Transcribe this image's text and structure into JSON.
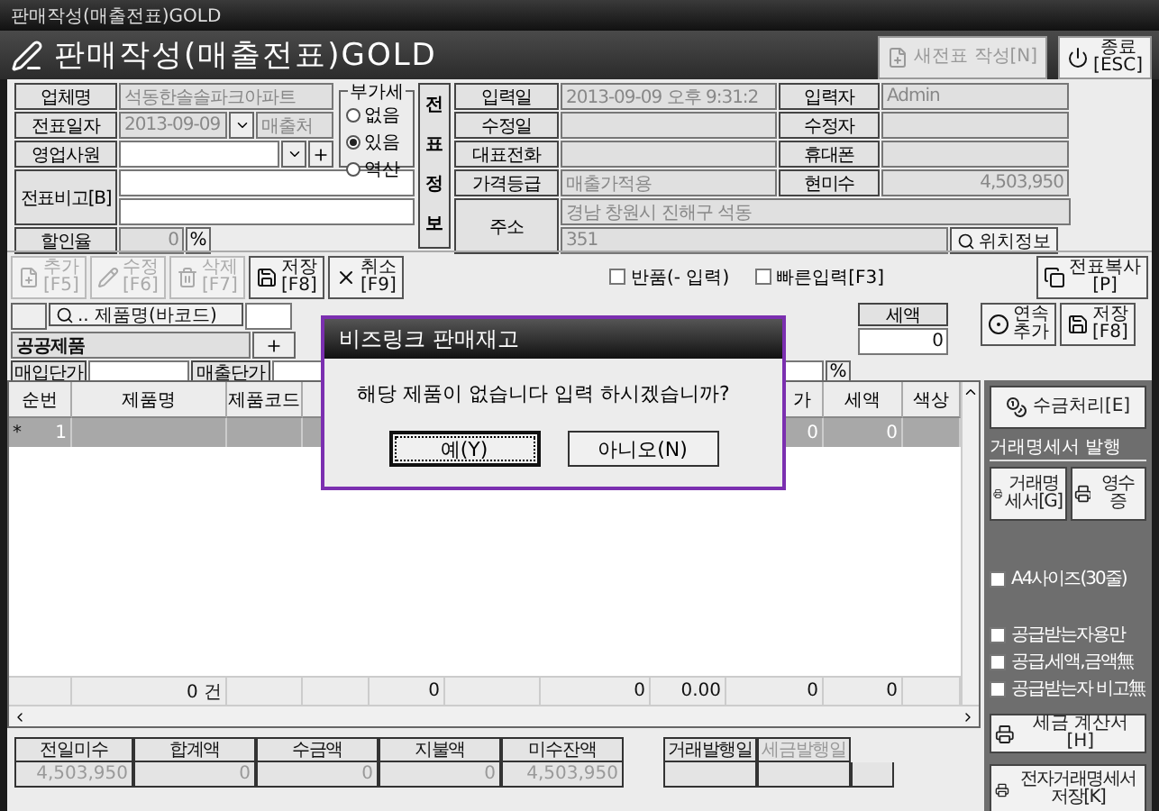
{
  "window": {
    "title": "판매작성(매출전표)GOLD"
  },
  "header": {
    "title": "판매작성(매출전표)GOLD",
    "buttons": [
      {
        "kind": "new",
        "label": "새전표 작성[N]",
        "disabled": true
      },
      {
        "kind": "exit",
        "label": "종료",
        "key": "[ESC]",
        "disabled": false
      }
    ]
  },
  "form": {
    "company": {
      "label": "업체명",
      "value": "석동한솔솔파크아파트"
    },
    "date": {
      "label": "전표일자",
      "value": "2013-09-09",
      "customer_placeholder": "매출처"
    },
    "salesperson": {
      "label": "영업사원"
    },
    "memo": {
      "label": "전표비고[B]"
    },
    "discount": {
      "label": "할인율",
      "value": "0",
      "unit": "%"
    }
  },
  "vat": {
    "legend": "부가세",
    "options": [
      {
        "label": "없음",
        "selected": false
      },
      {
        "label": "있음",
        "selected": true
      },
      {
        "label": "역산",
        "selected": false
      }
    ]
  },
  "info": {
    "title": "전표정보",
    "rows": [
      {
        "label": "입력일",
        "value": "2013-09-09 오후 9:31:2",
        "label2": "입력자",
        "value2": "Admin"
      },
      {
        "label": "수정일",
        "label2": "수정자"
      },
      {
        "label": "대표전화",
        "label2": "휴대폰"
      },
      {
        "label": "가격등급",
        "value": "매출가적용",
        "label2": "현미수",
        "value2": "4,503,950"
      }
    ],
    "address": {
      "label": "주소",
      "line1": "경남 창원시 진해구 석동",
      "line2": "351",
      "button": "위치정보"
    }
  },
  "toolbar": {
    "buttons": [
      {
        "kind": "add",
        "label": "추가",
        "key": "[F5]",
        "disabled": true
      },
      {
        "kind": "edit",
        "label": "수정",
        "key": "[F6]",
        "disabled": true
      },
      {
        "kind": "delete",
        "label": "삭제",
        "key": "[F7]",
        "disabled": true
      },
      {
        "kind": "save",
        "label": "저장",
        "key": "[F8]",
        "disabled": false
      },
      {
        "kind": "cancel",
        "label": "취소",
        "key": "[F9]",
        "disabled": false
      }
    ],
    "checkboxes": [
      {
        "label": "반품(- 입력)",
        "checked": false
      },
      {
        "label": "빠른입력[F3]",
        "checked": false
      }
    ],
    "copy_button": {
      "label": "전표복사",
      "key": "[P]"
    }
  },
  "entry": {
    "search_button": "..  제품명(바코드)",
    "product": "공공제품",
    "purchase_price_label": "매입단가",
    "sale_price_label": "매출단가",
    "percent": "%",
    "tax_header": "세액",
    "tax_value": "0",
    "buttons": [
      {
        "kind": "continuous",
        "label": "연속",
        "key": "추가"
      },
      {
        "kind": "save",
        "label": "저장",
        "key": "[F8]"
      }
    ]
  },
  "table": {
    "columns": [
      {
        "header": "순번"
      },
      {
        "header": "제품명",
        "total": "0 건"
      },
      {
        "header": "제품코드"
      },
      {},
      {
        "total": "0"
      },
      {},
      {
        "total": "0"
      },
      {
        "total": "0.00"
      },
      {
        "header": "가",
        "total": "0"
      },
      {
        "header": "세액",
        "total": "0"
      },
      {
        "header": "색상"
      }
    ],
    "rows": [
      {
        "marker": "*",
        "selected": true,
        "number": "1",
        "amount": "0",
        "tax": "0"
      }
    ]
  },
  "sidebar": {
    "collect_button": "수금처리[E]",
    "group_title": "거래명세서 발행",
    "print_buttons": [
      "거래명세서[G]",
      "영수증"
    ],
    "options": [
      {
        "label": "A4사이즈(30줄)",
        "checked": false
      },
      {
        "label": "공급받는자용만",
        "checked": false
      },
      {
        "label": "공급,세액,금액無",
        "checked": false
      },
      {
        "label": "공급받는자 비고無",
        "checked": false
      }
    ],
    "tax_invoice_button": "세금 계산서[H]",
    "e_statement_button": "전자거래명세서 저장[K]"
  },
  "summary": {
    "fields": [
      {
        "label": "전일미수",
        "value": "4,503,950"
      },
      {
        "label": "합계액",
        "value": "0"
      },
      {
        "label": "수금액",
        "value": "0"
      },
      {
        "label": "지불액",
        "value": "0"
      },
      {
        "label": "미수잔액",
        "value": "4,503,950"
      }
    ],
    "dates": [
      {
        "label": "거래발행일",
        "disabled": false
      },
      {
        "label": "세금발행일",
        "disabled": true
      }
    ]
  },
  "dialog": {
    "title": "비즈링크 판매재고",
    "message": "해당 제품이 없습니다 입력 하시겠습니까?",
    "buttons": [
      {
        "label": "예(Y)",
        "selected": true
      },
      {
        "label": "아니오(N)",
        "selected": false
      }
    ]
  }
}
